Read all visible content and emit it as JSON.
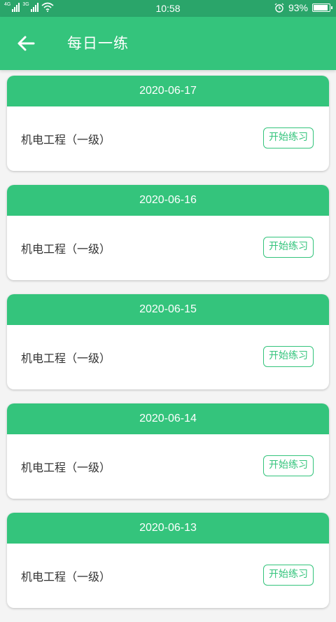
{
  "status_bar": {
    "network_1": "4G",
    "network_2": "3G",
    "time": "10:58",
    "battery_percent": "93%",
    "battery_level": 0.93
  },
  "app_bar": {
    "title": "每日一练",
    "back_icon": "arrow-left-icon"
  },
  "practice_items": [
    {
      "date": "2020-06-17",
      "subject": "机电工程（一级）",
      "button_label": "开始练习"
    },
    {
      "date": "2020-06-16",
      "subject": "机电工程（一级）",
      "button_label": "开始练习"
    },
    {
      "date": "2020-06-15",
      "subject": "机电工程（一级）",
      "button_label": "开始练习"
    },
    {
      "date": "2020-06-14",
      "subject": "机电工程（一级）",
      "button_label": "开始练习"
    },
    {
      "date": "2020-06-13",
      "subject": "机电工程（一级）",
      "button_label": "开始练习"
    }
  ],
  "colors": {
    "status_bar": "#2aa56a",
    "primary": "#34c47c",
    "background": "#f4f4f4"
  }
}
